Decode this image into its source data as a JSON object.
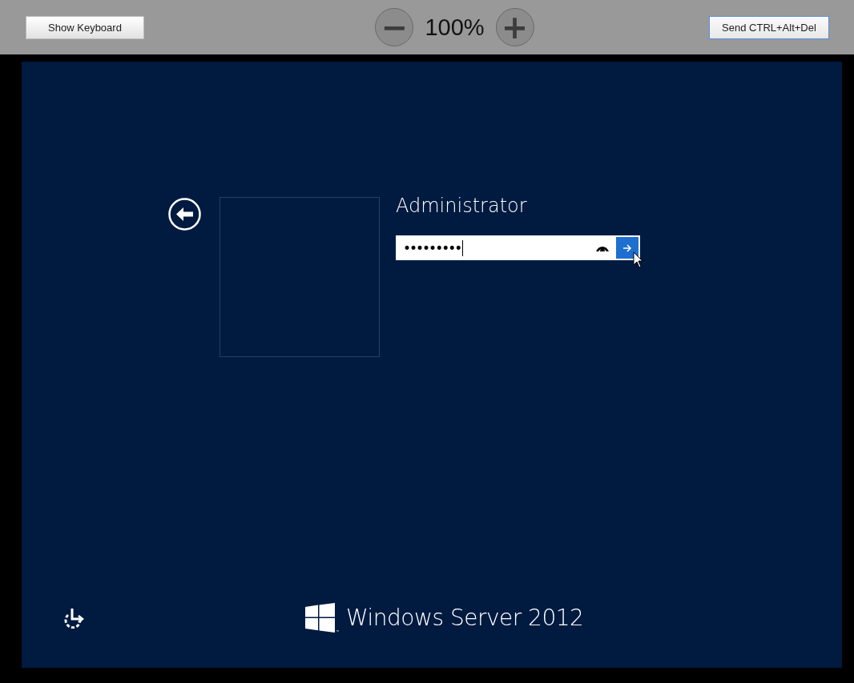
{
  "toolbar": {
    "show_keyboard": "Show Keyboard",
    "zoom_out": "−",
    "zoom_level": "100%",
    "zoom_in": "+",
    "send_keys": "Send CTRL+Alt+Del"
  },
  "login": {
    "user_name": "Administrator",
    "password_value": "•••••••••"
  },
  "branding": {
    "product": "Windows Server 2012",
    "trademark": "™"
  }
}
